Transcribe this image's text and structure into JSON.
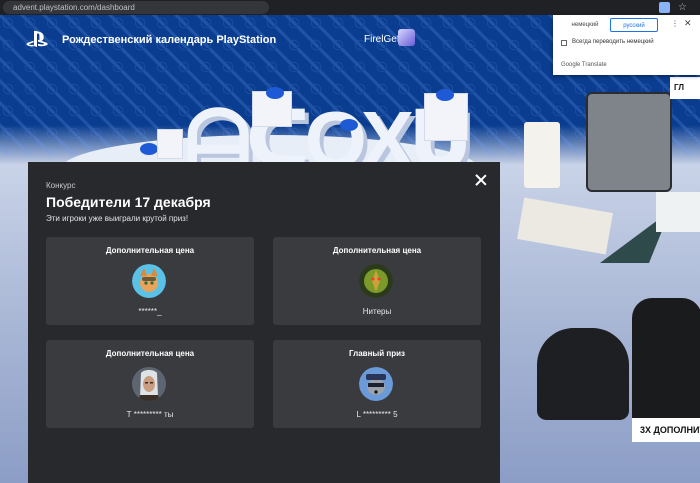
{
  "browser": {
    "url": "advent.playstation.com/dashboard"
  },
  "site": {
    "title": "Рождественский календарь PlayStation",
    "username": "FirelGef",
    "right_badge": "ГЛ",
    "bonus_badge": "3Х ДОПОЛНИТ"
  },
  "modal": {
    "eyebrow": "Конкурс",
    "title": "Победители 17 декабря",
    "subtitle": "Эти игроки уже выиграли крутой приз!",
    "cards": [
      {
        "title": "Дополнительная цена",
        "name": "******_",
        "avatar": "ratchet-clank-avatar"
      },
      {
        "title": "Дополнительная цена",
        "name": "Нитеры",
        "avatar": "demon-avatar"
      },
      {
        "title": "Дополнительная цена",
        "name": "Т ********* ты",
        "avatar": "witcher-avatar"
      },
      {
        "title": "Главный приз",
        "name": "L ********* 5",
        "avatar": "sly-cooper-avatar"
      }
    ]
  },
  "translate_popup": {
    "tab_source": "немецкий",
    "tab_target": "русский",
    "checkbox_label": "Всегда переводить немецкий",
    "brand": "Google Translate"
  },
  "colors": {
    "ps_blue": "#0a3d8f",
    "modal_bg": "#28292d",
    "card_bg": "#3a3b3f",
    "translate_accent": "#1a73e8"
  }
}
